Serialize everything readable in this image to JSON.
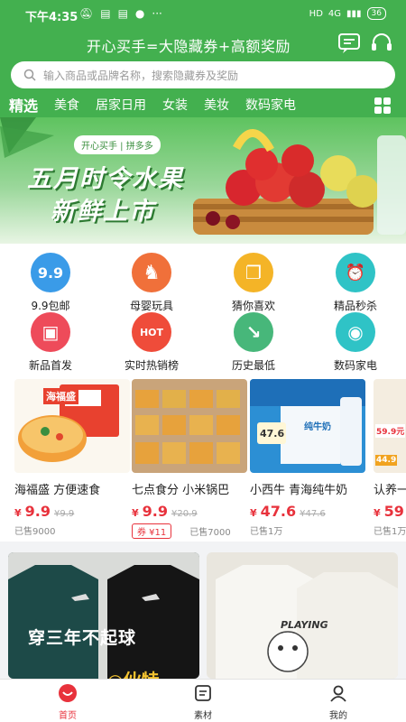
{
  "status_bar": {
    "time": "下午4:35",
    "network": "4G",
    "battery": "36"
  },
  "header": {
    "slogan": "开心买手=大隐藏券+高额奖励",
    "message_icon": "message-icon",
    "service_icon": "headset-icon"
  },
  "search": {
    "placeholder": "输入商品或品牌名称，搜索隐藏券及奖励",
    "icon": "search-icon"
  },
  "tabs": [
    "精选",
    "美食",
    "居家日用",
    "女装",
    "美妆",
    "数码家电"
  ],
  "banner": {
    "pill": "开心买手 | 拼多多",
    "line1": "五月时令水果",
    "line2": "新鲜上市"
  },
  "categories": [
    {
      "label": "9.9包邮",
      "glyph": "9.9",
      "color": "#3a9be8",
      "icon": "nine-nine-icon"
    },
    {
      "label": "母婴玩具",
      "glyph": "♞",
      "color": "#f0703a",
      "icon": "rocking-horse-icon"
    },
    {
      "label": "猜你喜欢",
      "glyph": "❐",
      "color": "#f4b427",
      "icon": "book-icon"
    },
    {
      "label": "精品秒杀",
      "glyph": "⏰",
      "color": "#2fc3c6",
      "icon": "clock-icon"
    },
    {
      "label": "新品首发",
      "glyph": "▣",
      "color": "#ee4b5a",
      "icon": "bag-icon"
    },
    {
      "label": "实时热销榜",
      "glyph": "HOT",
      "color": "#ef4c3a",
      "icon": "hot-icon"
    },
    {
      "label": "历史最低",
      "glyph": "↘",
      "color": "#47b77a",
      "icon": "trend-down-icon"
    },
    {
      "label": "数码家电",
      "glyph": "◉",
      "color": "#2fc3c6",
      "icon": "camera-icon"
    }
  ],
  "products": [
    {
      "title": "海福盛 方便速食",
      "currency": "¥",
      "price": "9.9",
      "old": "¥9.9",
      "sold": "已售9000",
      "coupon": ""
    },
    {
      "title": "七点食分 小米锅巴",
      "currency": "¥",
      "price": "9.9",
      "old": "¥20.9",
      "sold": "已售7000",
      "coupon": "券 ¥11"
    },
    {
      "title": "小西牛 青海纯牛奶",
      "currency": "¥",
      "price": "47.6",
      "old": "¥47.6",
      "sold": "已售1万",
      "coupon": ""
    },
    {
      "title": "认养一头牛",
      "currency": "¥",
      "price": "59",
      "old": "",
      "sold": "已售1万",
      "coupon": ""
    }
  ],
  "product_art": {
    "p1_brand": "海福盛",
    "p2_brand": "七点食分",
    "p3_brand": "纯牛奶",
    "p3_price_tag": "47.6",
    "p4_price": "59.9元",
    "p4_price2": "44.9"
  },
  "feed": {
    "card1_text": "穿三年不起球",
    "card1_sub": "◎伙特",
    "card2_text": "PLAYING"
  },
  "bottom_nav": [
    {
      "label": "首页",
      "icon": "home-icon",
      "active": true
    },
    {
      "label": "素材",
      "icon": "document-icon",
      "active": false
    },
    {
      "label": "我的",
      "icon": "user-icon",
      "active": false
    }
  ]
}
